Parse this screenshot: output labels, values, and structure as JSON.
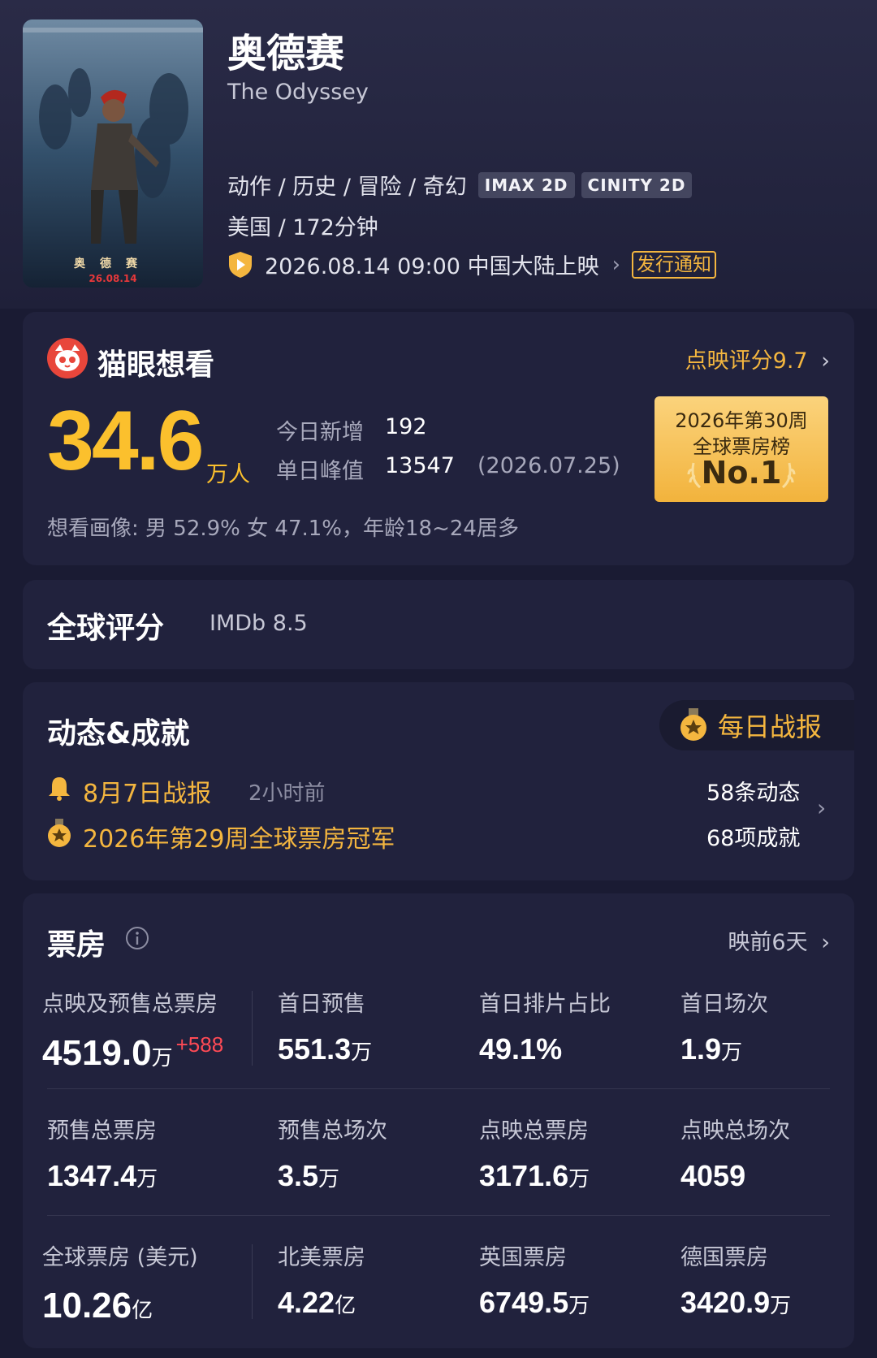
{
  "movie": {
    "title_cn": "奥德赛",
    "title_en": "The Odyssey",
    "genres": "动作 / 历史 / 冒险 / 奇幻",
    "tags": [
      "IMAX 2D",
      "CINITY 2D"
    ],
    "meta": "美国 / 172分钟",
    "release": "2026.08.14 09:00 中国大陆上映",
    "release_notice": "发行通知",
    "poster_title": "奥德赛",
    "poster_date": "26.08.14"
  },
  "want": {
    "title": "猫眼想看",
    "preview_score": "点映评分9.7",
    "count": "34.6",
    "unit": "万人",
    "today_label": "今日新增",
    "today_value": "192",
    "peak_label": "单日峰值",
    "peak_value": "13547",
    "peak_date": "(2026.07.25)",
    "rank_line1": "2026年第30周",
    "rank_line2": "全球票房榜",
    "rank_line3": "No.1",
    "portrait": "想看画像: 男 52.9%  女 47.1%，年龄18~24居多"
  },
  "global_rating": {
    "title": "全球评分",
    "imdb": "IMDb 8.5"
  },
  "dynamics": {
    "title": "动态&成就",
    "daily_report": "每日战报",
    "news1": "8月7日战报",
    "news1_time": "2小时前",
    "news2": "2026年第29周全球票房冠军",
    "dynamic_count": "58条动态",
    "achievement_count": "68项成就"
  },
  "box_office": {
    "title": "票房",
    "days_before": "映前6天",
    "row1": [
      {
        "label": "点映及预售总票房",
        "value": "4519.0",
        "unit": "万",
        "delta": "+588"
      },
      {
        "label": "首日预售",
        "value": "551.3",
        "unit": "万"
      },
      {
        "label": "首日排片占比",
        "value": "49.1%",
        "unit": ""
      },
      {
        "label": "首日场次",
        "value": "1.9",
        "unit": "万"
      }
    ],
    "row2": [
      {
        "label": "预售总票房",
        "value": "1347.4",
        "unit": "万"
      },
      {
        "label": "预售总场次",
        "value": "3.5",
        "unit": "万"
      },
      {
        "label": "点映总票房",
        "value": "3171.6",
        "unit": "万"
      },
      {
        "label": "点映总场次",
        "value": "4059",
        "unit": ""
      }
    ],
    "row3": [
      {
        "label": "全球票房 (美元)",
        "value": "10.26",
        "unit": "亿"
      },
      {
        "label": "北美票房",
        "value": "4.22",
        "unit": "亿"
      },
      {
        "label": "英国票房",
        "value": "6749.5",
        "unit": "万"
      },
      {
        "label": "德国票房",
        "value": "3420.9",
        "unit": "万"
      }
    ]
  },
  "colors": {
    "background": "#1a1b33",
    "card": "#21223d",
    "accent_gold": "#f4b63f",
    "accent_red": "#ff4a55"
  }
}
